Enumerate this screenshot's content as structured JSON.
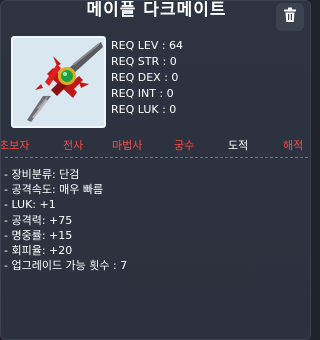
{
  "item": {
    "name": "메이플 다크메이트",
    "icon": "dagger-icon"
  },
  "toolbar": {
    "delete_icon": "trash-icon"
  },
  "requirements": [
    "REQ LEV : 64",
    "REQ STR : 0",
    "REQ DEX : 0",
    "REQ INT : 0",
    "REQ LUK : 0"
  ],
  "jobs": [
    {
      "label": "초보자",
      "available": false
    },
    {
      "label": "전사",
      "available": false
    },
    {
      "label": "마법사",
      "available": false
    },
    {
      "label": "궁수",
      "available": false
    },
    {
      "label": "도적",
      "available": true
    },
    {
      "label": "해적",
      "available": false
    }
  ],
  "stats": [
    "- 장비분류: 단검",
    "- 공격속도: 매우 빠름",
    "- LUK: +1",
    "- 공격력: +75",
    "- 명중률: +15",
    "- 회피율: +20",
    "- 업그레이드 가능 횟수 : 7"
  ],
  "colors": {
    "background": "#2b313e",
    "unavailable_job": "#ff4a44",
    "available_job": "#ffffff"
  }
}
